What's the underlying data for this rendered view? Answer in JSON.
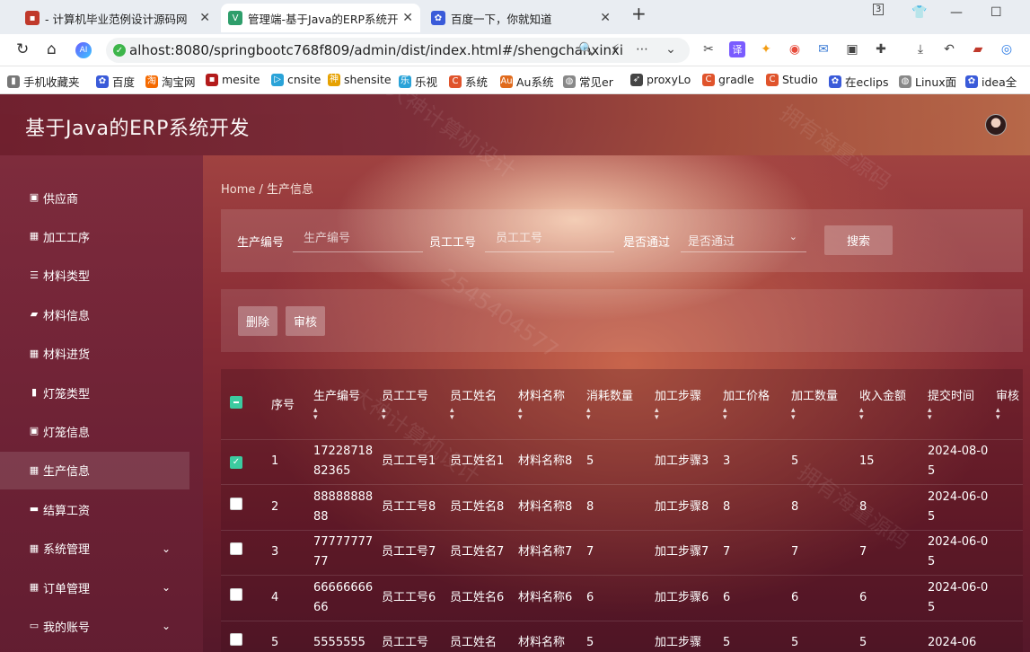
{
  "browser": {
    "tabs": [
      {
        "title": "- 计算机毕业范例设计源码网",
        "color": "#c0392b"
      },
      {
        "title": "管理端-基于Java的ERP系统开",
        "color": "#2e9e6b"
      },
      {
        "title": "百度一下，你就知道",
        "color": "#3a5bd9"
      }
    ],
    "new_tab": "+",
    "url": "alhost:8080/springbootc768f809/admin/dist/index.html#/shengchanxinxi",
    "tab_count_badge": "3",
    "bookmarks": [
      "手机收藏夹",
      "百度",
      "淘宝网",
      "mesite",
      "cnsite",
      "shensite",
      "乐视",
      "系统",
      "Au系统",
      "常见er",
      "proxyLo",
      "gradle",
      "Studio",
      "在eclips",
      "Linux面",
      "idea全"
    ]
  },
  "app": {
    "title": "基于Java的ERP系统开发",
    "breadcrumb": "Home / 生产信息",
    "menu": [
      {
        "label": "供应商",
        "icon": "supplier-icon",
        "glyph": "▣"
      },
      {
        "label": "加工工序",
        "icon": "grid-icon",
        "glyph": "▦"
      },
      {
        "label": "材料类型",
        "icon": "list-icon",
        "glyph": "☰"
      },
      {
        "label": "材料信息",
        "icon": "box-icon",
        "glyph": "▰"
      },
      {
        "label": "材料进货",
        "icon": "grid-icon",
        "glyph": "▦"
      },
      {
        "label": "灯笼类型",
        "icon": "bar-chart-icon",
        "glyph": "▮"
      },
      {
        "label": "灯笼信息",
        "icon": "clipboard-icon",
        "glyph": "▣"
      },
      {
        "label": "生产信息",
        "icon": "grid-icon",
        "glyph": "▦",
        "active": true
      },
      {
        "label": "结算工资",
        "icon": "ticket-icon",
        "glyph": "▬"
      },
      {
        "label": "系统管理",
        "icon": "grid-icon",
        "glyph": "▦",
        "expandable": true
      },
      {
        "label": "订单管理",
        "icon": "grid-icon",
        "glyph": "▦",
        "expandable": true
      },
      {
        "label": "我的账号",
        "icon": "account-icon",
        "glyph": "▭",
        "expandable": true
      }
    ],
    "search": {
      "field1_label": "生产编号",
      "field1_placeholder": "生产编号",
      "field2_label": "员工工号",
      "field2_placeholder": "员工工号",
      "field3_label": "是否通过",
      "field3_value": "是否通过",
      "button": "搜索"
    },
    "actions": {
      "delete": "删除",
      "audit": "审核"
    },
    "table": {
      "columns": [
        "序号",
        "生产编号",
        "员工工号",
        "员工姓名",
        "材料名称",
        "消耗数量",
        "加工步骤",
        "加工价格",
        "加工数量",
        "收入金额",
        "提交时间",
        "审核"
      ],
      "rows": [
        {
          "checked": true,
          "cells": [
            "1",
            "1722871882365",
            "员工工号1",
            "员工姓名1",
            "材料名称8",
            "5",
            "加工步骤3",
            "3",
            "5",
            "15",
            "2024-08-05"
          ]
        },
        {
          "checked": false,
          "cells": [
            "2",
            "8888888888",
            "员工工号8",
            "员工姓名8",
            "材料名称8",
            "8",
            "加工步骤8",
            "8",
            "8",
            "8",
            "2024-06-05"
          ]
        },
        {
          "checked": false,
          "cells": [
            "3",
            "7777777777",
            "员工工号7",
            "员工姓名7",
            "材料名称7",
            "7",
            "加工步骤7",
            "7",
            "7",
            "7",
            "2024-06-05"
          ]
        },
        {
          "checked": false,
          "cells": [
            "4",
            "6666666666",
            "员工工号6",
            "员工姓名6",
            "材料名称6",
            "6",
            "加工步骤6",
            "6",
            "6",
            "6",
            "2024-06-05"
          ]
        },
        {
          "checked": false,
          "cells": [
            "5",
            "5555555",
            "员工工号",
            "员工姓名",
            "材料名称",
            "5",
            "加工步骤",
            "5",
            "5",
            "5",
            "2024-06"
          ]
        }
      ]
    }
  },
  "watermarks": [
    "大神计算机设计",
    "拥有海量源码",
    "2545404577"
  ]
}
